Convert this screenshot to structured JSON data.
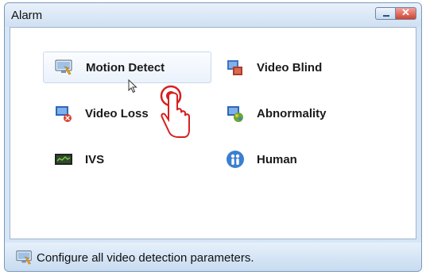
{
  "window": {
    "title": "Alarm"
  },
  "items": [
    {
      "label": "Motion Detect",
      "icon": "motion-detect-icon",
      "selected": true
    },
    {
      "label": "Video Blind",
      "icon": "video-blind-icon"
    },
    {
      "label": "Video Loss",
      "icon": "video-loss-icon"
    },
    {
      "label": "Abnormality",
      "icon": "abnormality-icon"
    },
    {
      "label": "IVS",
      "icon": "ivs-icon"
    },
    {
      "label": "Human",
      "icon": "human-icon"
    }
  ],
  "status": {
    "text": "Configure all video detection parameters.",
    "icon": "motion-detect-icon"
  },
  "colors": {
    "window_bg": "#d6e6f6",
    "selection": "#eaf2fb",
    "close": "#d2412f"
  }
}
